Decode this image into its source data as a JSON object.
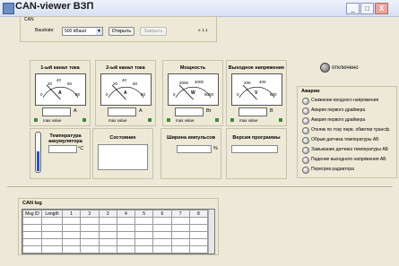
{
  "window": {
    "title": "CAN-viewer ВЗП",
    "min": "_",
    "max": "□",
    "close": "X"
  },
  "can": {
    "group_label": "CAN",
    "baudrate_label": "Baudrate:",
    "baudrate_value": "500 kBaud",
    "open_button": "Открыть",
    "close_button": "Закрыть",
    "version": "v. 1.1"
  },
  "status": {
    "text": "отключено"
  },
  "meters": [
    {
      "title": "1-ый канал тока",
      "unit": "A",
      "scale_label": "A",
      "ticks": [
        "0",
        "20",
        "40",
        "60",
        "80"
      ],
      "footer": "max value"
    },
    {
      "title": "2-ый канал тока",
      "unit": "A",
      "scale_label": "A",
      "ticks": [
        "0",
        "20",
        "40",
        "60",
        "80"
      ],
      "footer": "max value"
    },
    {
      "title": "Мощность",
      "unit": "Вт",
      "scale_label": "W",
      "ticks": [
        "0",
        "2000",
        "4000",
        "6000"
      ],
      "footer": "max value"
    },
    {
      "title": "Выходное напряжение",
      "unit": "В",
      "scale_label": "V",
      "ticks": [
        "0",
        "200",
        "400",
        "600"
      ],
      "footer": "max value"
    }
  ],
  "alarms": {
    "title": "Аварии",
    "items": [
      "Снижение входного напряжения",
      "Авария первого драйвера",
      "Авария первого драйвера",
      "Отклик по току перв. обмотки трансф.",
      "Обрыв датчика температуры АБ",
      "Замыкание датчика температуры АБ",
      "Падение выходного напряжения АБ",
      "Перегрев радиатора"
    ]
  },
  "bottom": {
    "temperature": {
      "title": "Температура аккумулятора",
      "unit": "°C"
    },
    "state": {
      "title": "Состояние"
    },
    "pulse_width": {
      "title": "Ширина импульсов",
      "unit": "%"
    },
    "version": {
      "title": "Версия программы"
    }
  },
  "canlog": {
    "title": "CAN log",
    "columns": [
      "Msg ID",
      "Length",
      "1",
      "2",
      "3",
      "4",
      "5",
      "6",
      "7",
      "8"
    ]
  },
  "colors": {
    "status_led": "#7a7a7a",
    "meter_led": "#3c8a3c",
    "close_btn": "#e8a6a0"
  }
}
